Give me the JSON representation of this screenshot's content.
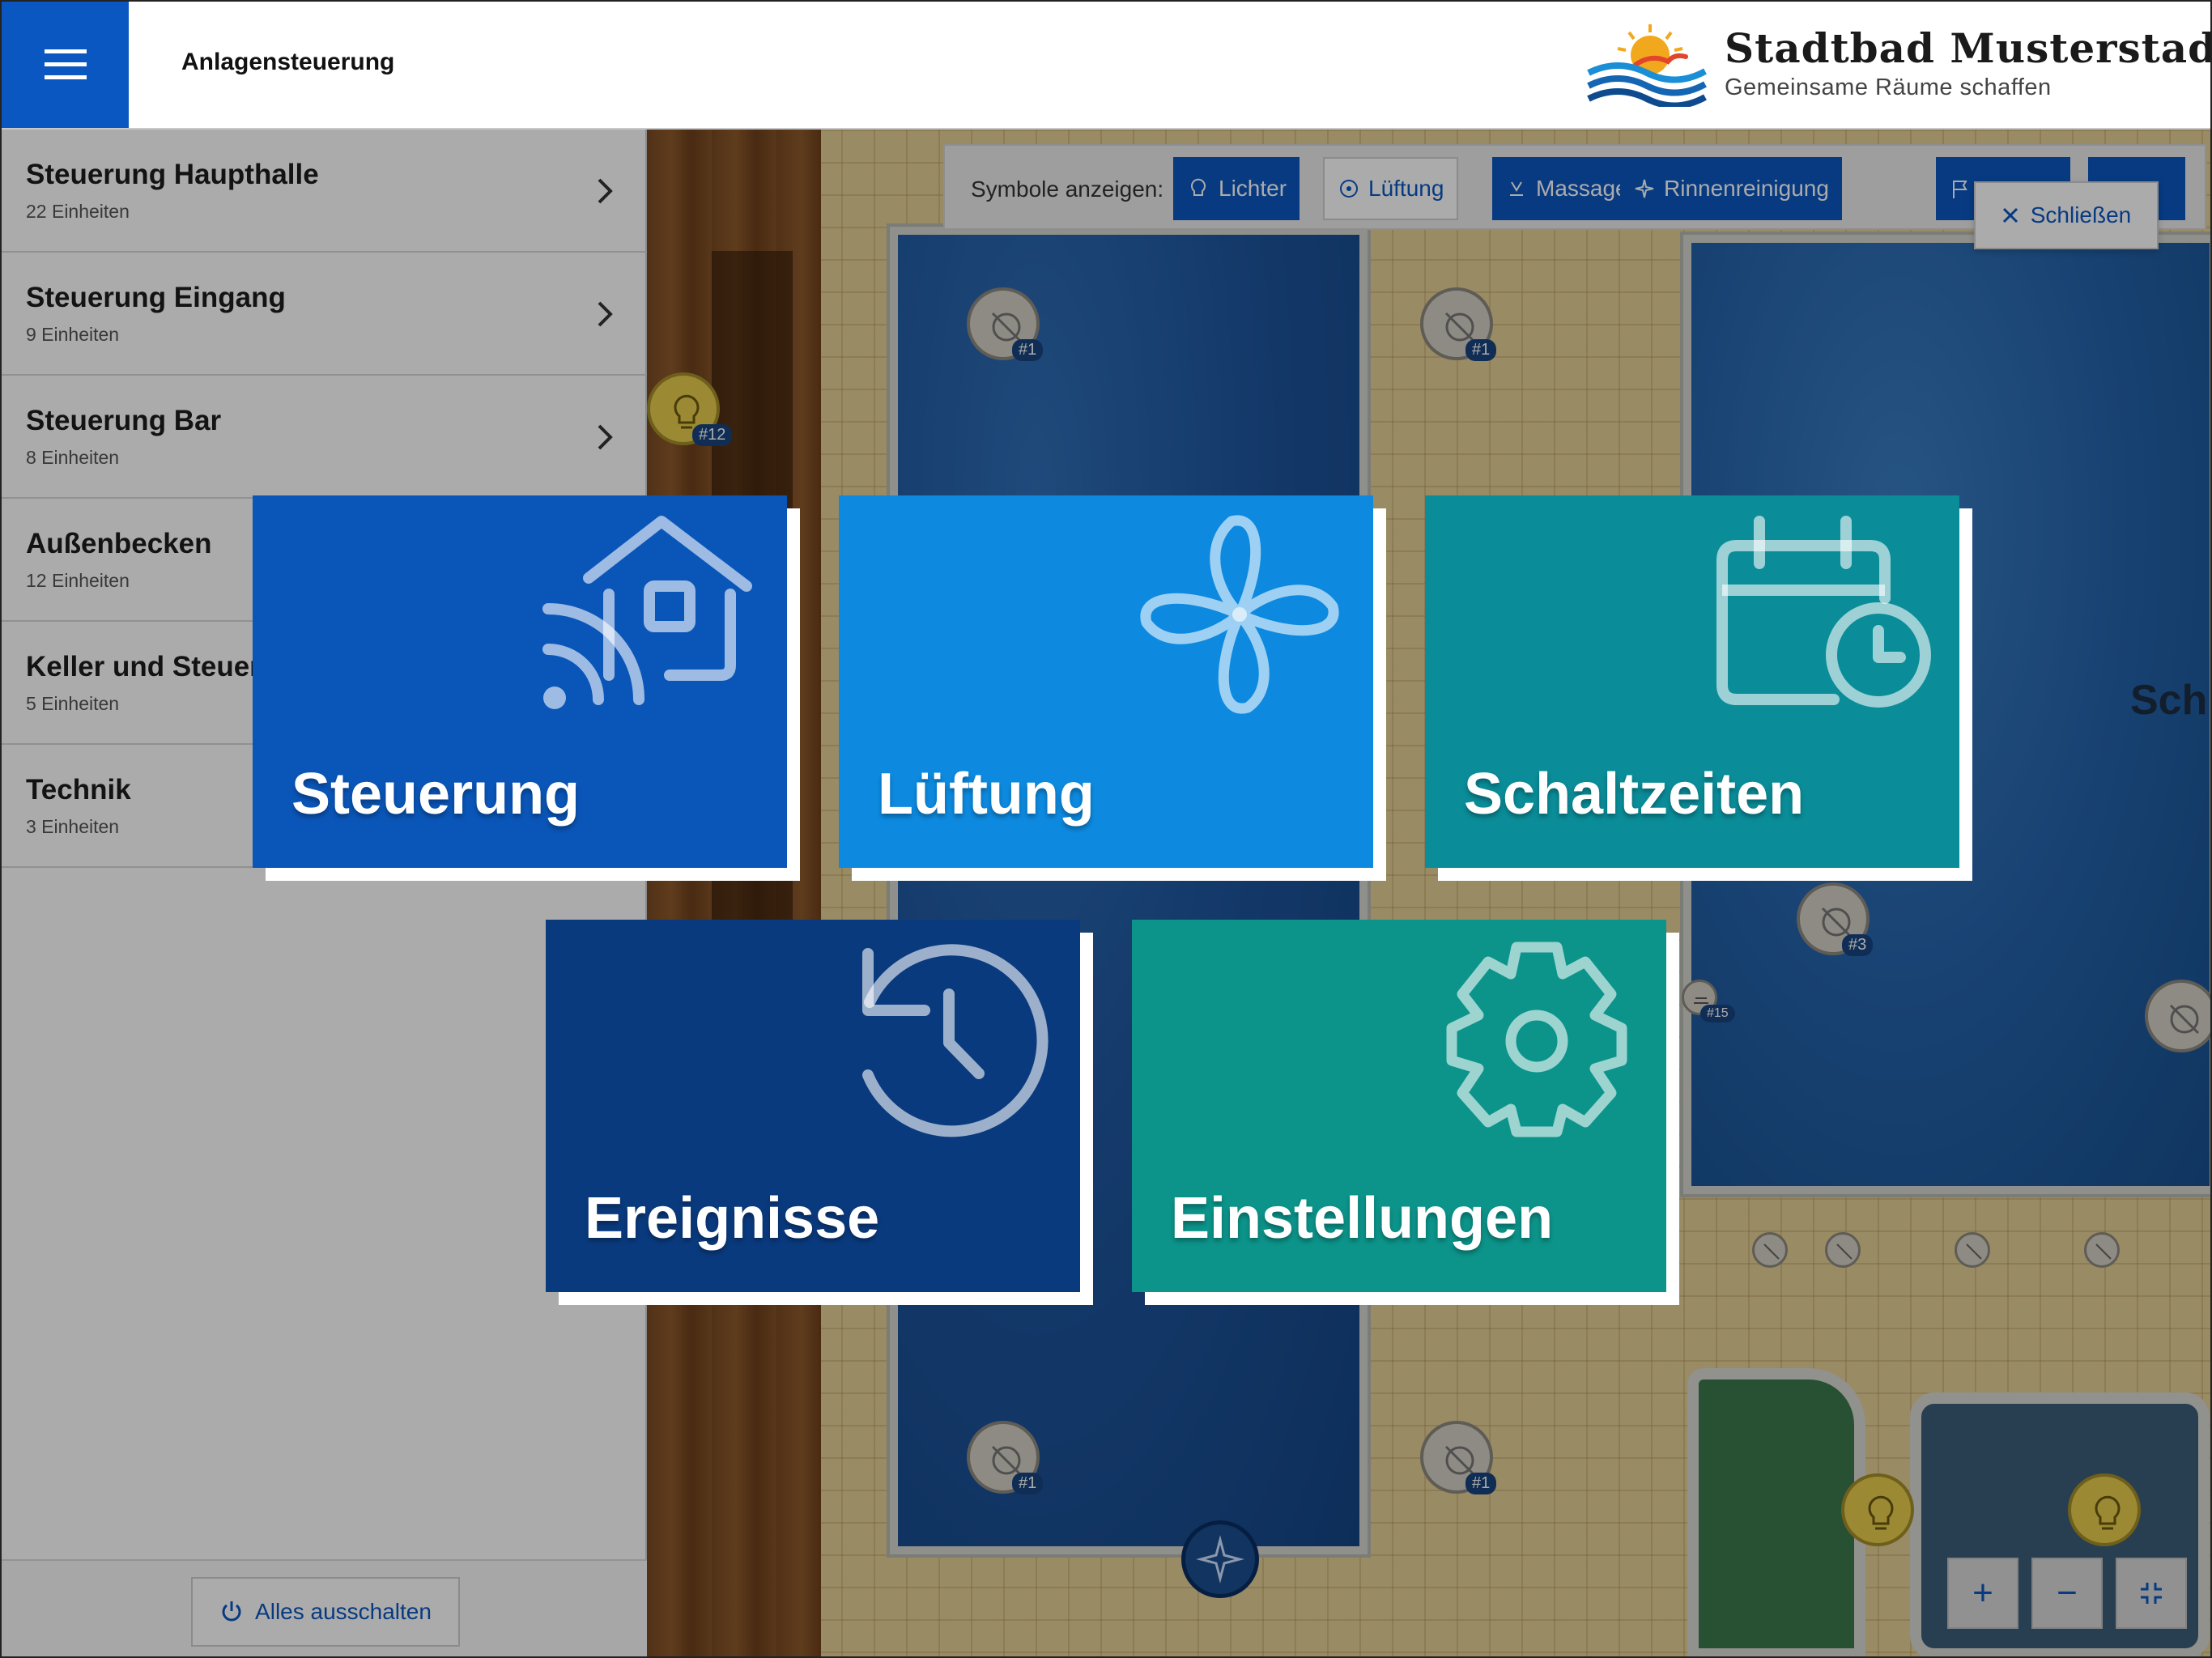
{
  "header": {
    "app_title": "Anlagensteuerung",
    "brand_name": "Stadtbad Musterstadt",
    "brand_tagline": "Gemeinsame Räume schaffen"
  },
  "sidebar": {
    "items": [
      {
        "label": "Steuerung Haupthalle",
        "count": "22 Einheiten"
      },
      {
        "label": "Steuerung Eingang",
        "count": "9 Einheiten"
      },
      {
        "label": "Steuerung Bar",
        "count": "8 Einheiten"
      },
      {
        "label": "Außenbecken",
        "count": "12 Einheiten"
      },
      {
        "label": "Keller und Steuerung",
        "count": "5 Einheiten"
      },
      {
        "label": "Technik",
        "count": "3 Einheiten"
      }
    ],
    "footer_button": "Alles ausschalten"
  },
  "map": {
    "toolbar_label": "Symbole anzeigen:",
    "filters": [
      "Lichter",
      "Lüftung",
      "Massagedüsen",
      "Rinnenreinigung"
    ],
    "close_label": "Schließen",
    "tags": {
      "t1": "#1",
      "t3": "#3",
      "t12": "#12",
      "t15": "#15"
    },
    "partial_label": "Sch",
    "zoom_in": "+",
    "zoom_out": "−"
  },
  "tiles": [
    {
      "label": "Steuerung",
      "icon": "smart-home-icon"
    },
    {
      "label": "Lüftung",
      "icon": "fan-icon"
    },
    {
      "label": "Schaltzeiten",
      "icon": "calendar-clock-icon"
    },
    {
      "label": "Ereignisse",
      "icon": "history-icon"
    },
    {
      "label": "Einstellungen",
      "icon": "gear-icon"
    }
  ],
  "colors": {
    "primary": "#0b57c1",
    "tile_steuerung": "#0a56b8",
    "tile_lueftung": "#0d8ae0",
    "tile_schaltzeiten": "#0a8d99",
    "tile_ereignisse": "#0a3a7e",
    "tile_einstellungen": "#0c948a"
  }
}
